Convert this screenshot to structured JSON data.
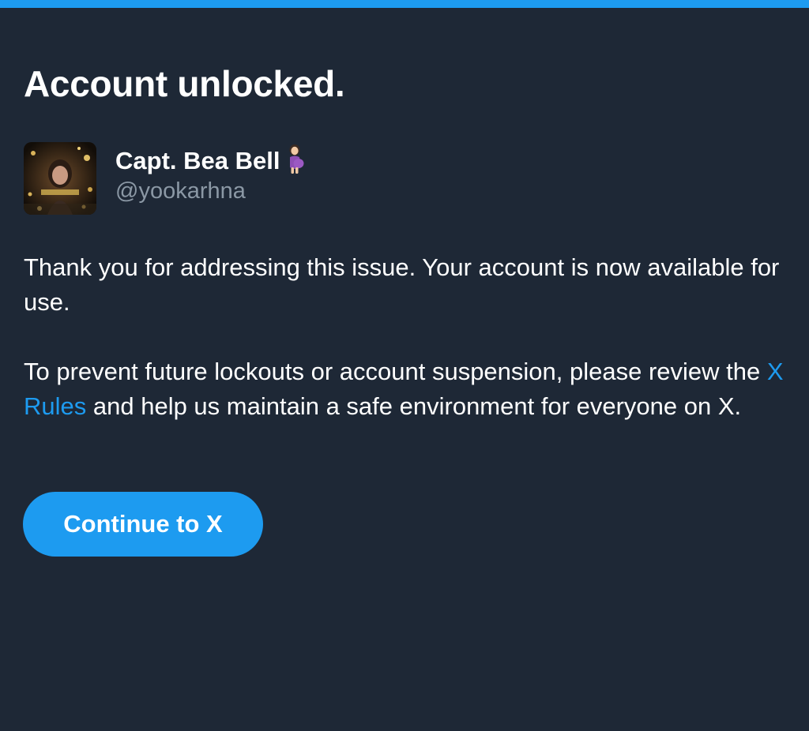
{
  "page": {
    "title": "Account unlocked."
  },
  "account": {
    "display_name": "Capt. Bea Bell",
    "name_emoji": "pregnant-woman-emoji",
    "handle": "@yookarhna",
    "avatar": "profile-photo"
  },
  "message": {
    "paragraph1": "Thank you for addressing this issue. Your account is now available for use.",
    "paragraph2_before": "To prevent future lockouts or account suspension, please review the ",
    "paragraph2_link": "X Rules",
    "paragraph2_after": " and help us maintain a safe environment for everyone on X."
  },
  "actions": {
    "continue_label": "Continue to X"
  },
  "colors": {
    "background": "#1e2836",
    "accent": "#1d9bf0",
    "secondary_text": "#8b98a5",
    "primary_text": "#ffffff"
  }
}
